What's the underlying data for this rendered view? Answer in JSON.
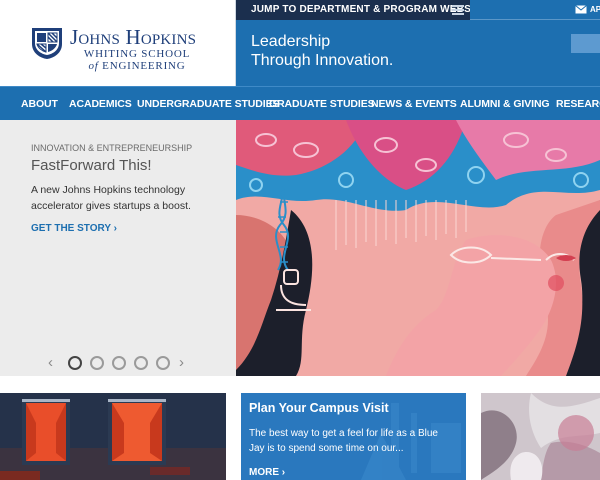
{
  "colors": {
    "brand_blue": "#1d6fb0",
    "nav_dark": "#1b2f4e",
    "link_blue": "#1d6fb0",
    "card_blue": "#2a78be",
    "panel_gray": "#ececec"
  },
  "header": {
    "logo": {
      "line1": "Johns Hopkins",
      "line2": "WHITING SCHOOL",
      "line3_prefix": "of",
      "line3_rest": " ENGINEERING",
      "icon": "jhu-shield-icon"
    },
    "jump_link": "JUMP TO DEPARTMENT & PROGRAM WEBSITES",
    "jump_menu_icon": "hamburger-menu-icon",
    "top_right_icon": "mail-icon",
    "top_right_text": "AP",
    "tagline_line1": "Leadership",
    "tagline_line2": "Through Innovation."
  },
  "nav": {
    "items": [
      {
        "label": "ABOUT"
      },
      {
        "label": "ACADEMICS"
      },
      {
        "label": "UNDERGRADUATE STUDIES"
      },
      {
        "label": "GRADUATE STUDIES"
      },
      {
        "label": "NEWS & EVENTS"
      },
      {
        "label": "ALUMNI & GIVING"
      },
      {
        "label": "RESEARCH"
      }
    ]
  },
  "hero": {
    "eyebrow": "INNOVATION & ENTREPRENEURSHIP",
    "title": "FastForward This!",
    "desc_line1": "A new Johns Hopkins technology",
    "desc_line2": "accelerator gives startups a boost.",
    "cta": "GET THE STORY ›",
    "carousel": {
      "prev_icon": "chevron-left-icon",
      "next_icon": "chevron-right-icon",
      "prev_glyph": "‹",
      "next_glyph": "›",
      "dot_count": 5,
      "active_index": 0
    }
  },
  "cards": {
    "middle": {
      "title": "Plan Your Campus Visit",
      "desc_line1": "The best way to get a feel for life as a Blue",
      "desc_line2": "Jay is to spend some time on our...",
      "cta": "MORE ›"
    }
  }
}
